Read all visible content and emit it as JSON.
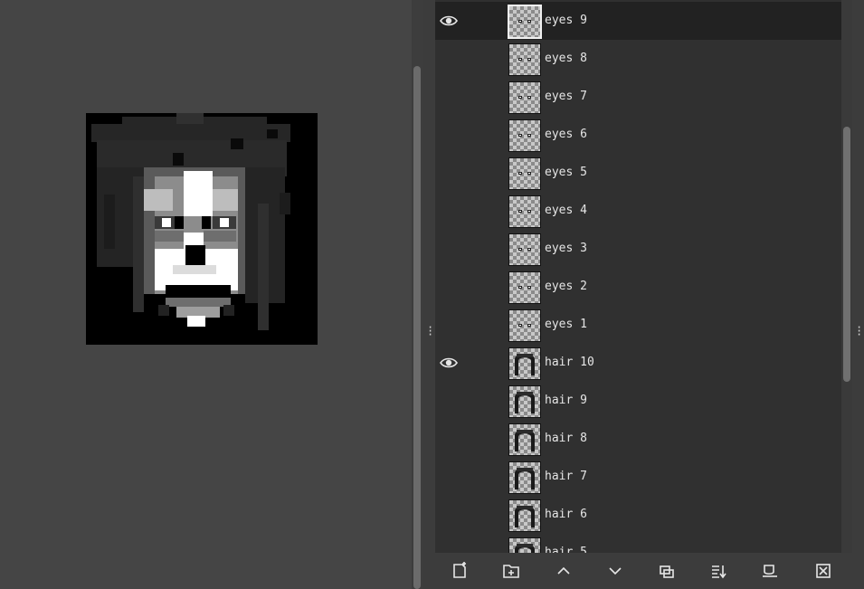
{
  "layers_panel": {
    "layers": [
      {
        "name": "eyes 9",
        "visible": true,
        "selected": true,
        "thumb": "eyes"
      },
      {
        "name": "eyes 8",
        "visible": false,
        "selected": false,
        "thumb": "eyes"
      },
      {
        "name": "eyes 7",
        "visible": false,
        "selected": false,
        "thumb": "eyes"
      },
      {
        "name": "eyes 6",
        "visible": false,
        "selected": false,
        "thumb": "eyes"
      },
      {
        "name": "eyes 5",
        "visible": false,
        "selected": false,
        "thumb": "eyes"
      },
      {
        "name": "eyes 4",
        "visible": false,
        "selected": false,
        "thumb": "eyes"
      },
      {
        "name": "eyes 3",
        "visible": false,
        "selected": false,
        "thumb": "eyes"
      },
      {
        "name": "eyes 2",
        "visible": false,
        "selected": false,
        "thumb": "eyes"
      },
      {
        "name": "eyes 1",
        "visible": false,
        "selected": false,
        "thumb": "eyes"
      },
      {
        "name": "hair 10",
        "visible": true,
        "selected": false,
        "thumb": "hair"
      },
      {
        "name": "hair 9",
        "visible": false,
        "selected": false,
        "thumb": "hair"
      },
      {
        "name": "hair 8",
        "visible": false,
        "selected": false,
        "thumb": "hair"
      },
      {
        "name": "hair 7",
        "visible": false,
        "selected": false,
        "thumb": "hair"
      },
      {
        "name": "hair 6",
        "visible": false,
        "selected": false,
        "thumb": "hair"
      },
      {
        "name": "hair 5",
        "visible": false,
        "selected": false,
        "thumb": "hair"
      }
    ],
    "toolbar": [
      {
        "icon": "new-layer-icon"
      },
      {
        "icon": "new-layer-group-icon"
      },
      {
        "icon": "raise-layer-icon"
      },
      {
        "icon": "lower-layer-icon"
      },
      {
        "icon": "duplicate-layer-icon"
      },
      {
        "icon": "merge-layer-icon"
      },
      {
        "icon": "layer-mask-icon"
      },
      {
        "icon": "delete-layer-icon"
      }
    ]
  },
  "colors": {
    "panel_bg": "#303030",
    "selected_row": "#222222",
    "text": "#e6e6e6",
    "canvas_bg": "#454545"
  }
}
